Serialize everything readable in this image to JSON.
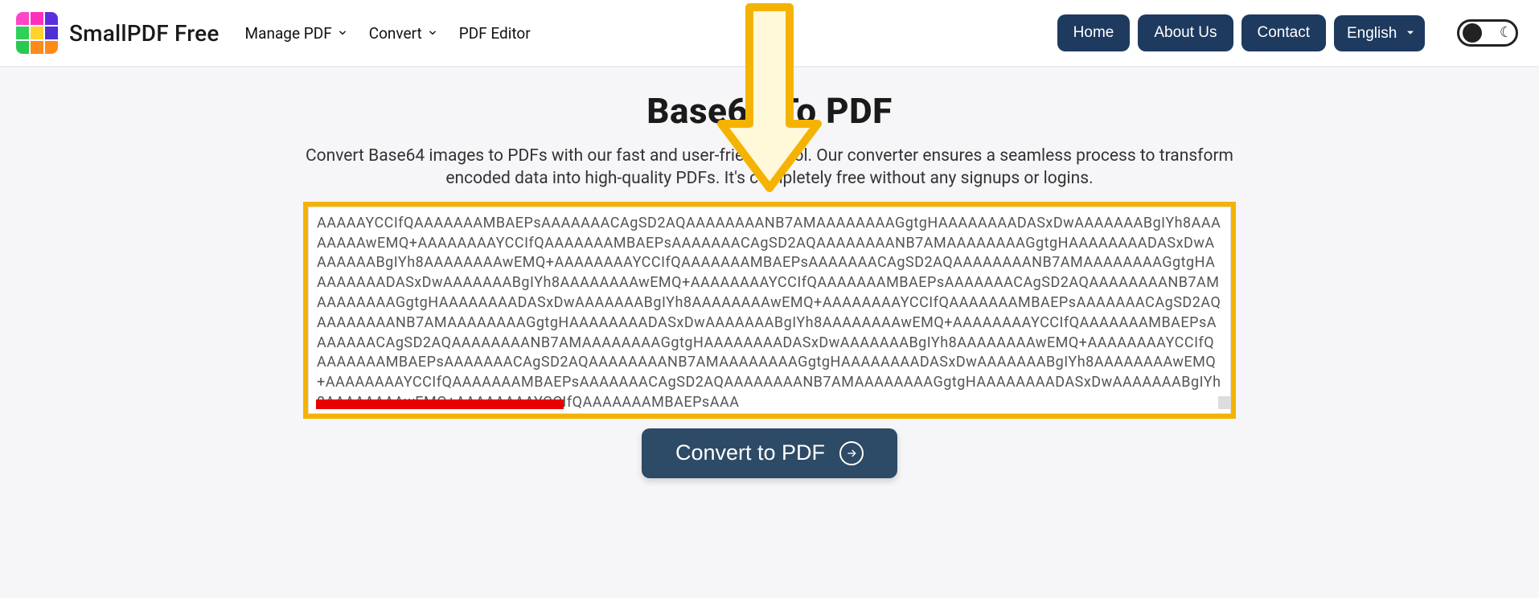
{
  "brand": "SmallPDF Free",
  "menus": {
    "manage_pdf": "Manage PDF",
    "convert": "Convert",
    "editor": "PDF Editor"
  },
  "nav": {
    "home": "Home",
    "about": "About Us",
    "contact": "Contact"
  },
  "language": {
    "selected": "English",
    "options": [
      "English"
    ]
  },
  "page": {
    "title": "Base64 To PDF",
    "description": "Convert Base64 images to PDFs with our fast and user-friendly tool. Our converter ensures a seamless process to transform encoded data into high-quality PDFs. It's completely free without any signups or logins."
  },
  "textarea": {
    "value": "AAAAAYCCIfQAAAAAAAMBAEPsAAAAAAACAgSD2AQAAAAAAAANB7AMAAAAAAAAGgtgHAAAAAAAADASxDwAAAAAAABgIYh8AAAAAAAAwEMQ+AAAAAAAAYCCIfQAAAAAAAMBAEPsAAAAAAACAgSD2AQAAAAAAAANB7AMAAAAAAAAGgtgHAAAAAAAADASxDwAAAAAAABgIYh8AAAAAAAAwEMQ+AAAAAAAAYCCIfQAAAAAAAMBAEPsAAAAAAACAgSD2AQAAAAAAAANB7AMAAAAAAAAGgtgHAAAAAAAADASxDwAAAAAAABgIYh8AAAAAAAAwEMQ+AAAAAAAAYCCIfQAAAAAAAMBAEPsAAAAAAACAgSD2AQAAAAAAAANB7AMAAAAAAAAGgtgHAAAAAAAADASxDwAAAAAAABgIYh8AAAAAAAAwEMQ+AAAAAAAAYCCIfQAAAAAAAMBAEPsAAAAAAACAgSD2AQAAAAAAAANB7AMAAAAAAAAGgtgHAAAAAAAADASxDwAAAAAAABgIYh8AAAAAAAAwEMQ+AAAAAAAAYCCIfQAAAAAAAMBAEPsAAAAAAACAgSD2AQAAAAAAAANB7AMAAAAAAAAGgtgHAAAAAAAADASxDwAAAAAAABgIYh8AAAAAAAAwEMQ+AAAAAAAAYCCIfQAAAAAAAMBAEPsAAAAAAACAgSD2AQAAAAAAAANB7AMAAAAAAAAGgtgHAAAAAAAADASxDwAAAAAAABgIYh8AAAAAAAAwEMQ+AAAAAAAAYCCIfQAAAAAAAMBAEPsAAAAAAACAgSD2AQAAAAAAAANB7AMAAAAAAAAGgtgHAAAAAAAADASxDwAAAAAAABgIYh8AAAAAAAAwEMQ+AAAAAAAAYCCIfQAAAAAAAMBAEPsAAA"
  },
  "convert_button": "Convert to PDF"
}
